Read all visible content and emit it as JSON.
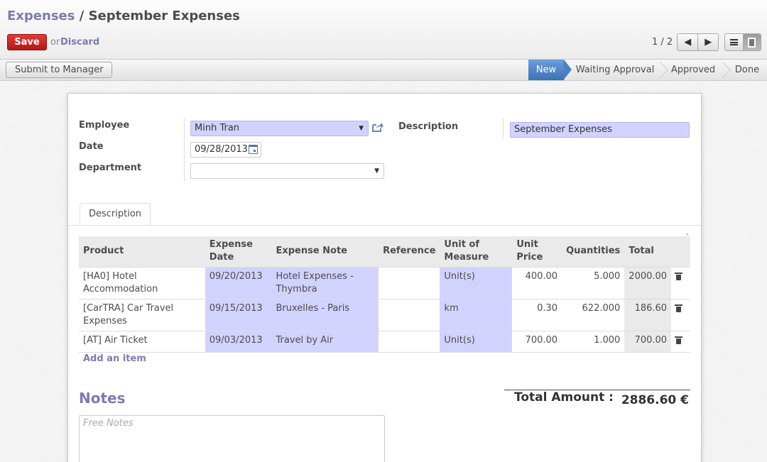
{
  "breadcrumb": {
    "parent": "Expenses",
    "separator": " / ",
    "current": "September Expenses"
  },
  "toolbar": {
    "save_label": "Save",
    "or_text": "or",
    "discard_label": "Discard"
  },
  "pager": {
    "text": "1 / 2",
    "prev_icon": "arrow-left-icon",
    "next_icon": "arrow-right-icon"
  },
  "view_switch": {
    "list_icon": "list-view-icon",
    "form_icon": "form-view-icon",
    "active": "form"
  },
  "statusbar": {
    "submit_label": "Submit to Manager",
    "stages": [
      {
        "label": "New",
        "active": true
      },
      {
        "label": "Waiting Approval",
        "active": false
      },
      {
        "label": "Approved",
        "active": false
      },
      {
        "label": "Done",
        "active": false
      }
    ]
  },
  "form": {
    "employee": {
      "label": "Employee",
      "value": "Minh Tran"
    },
    "date": {
      "label": "Date",
      "value": "09/28/2013"
    },
    "department": {
      "label": "Department",
      "value": ""
    },
    "description": {
      "label": "Description",
      "value": "September Expenses"
    }
  },
  "tabs": [
    {
      "label": "Description",
      "active": true
    }
  ],
  "lines": {
    "columns": [
      "Product",
      "Expense Date",
      "Expense Note",
      "Reference",
      "Unit of Measure",
      "Unit Price",
      "Quantities",
      "Total"
    ],
    "rows": [
      {
        "product": "[HA0] Hotel Accommodation",
        "date": "09/20/2013",
        "note": "Hotel Expenses - Thymbra",
        "reference": "",
        "uom": "Unit(s)",
        "price": "400.00",
        "qty": "5.000",
        "total": "2000.00"
      },
      {
        "product": "[CarTRA] Car Travel Expenses",
        "date": "09/15/2013",
        "note": "Bruxelles - Paris",
        "reference": "",
        "uom": "km",
        "price": "0.30",
        "qty": "622.000",
        "total": "186.60"
      },
      {
        "product": "[AT] Air Ticket",
        "date": "09/03/2013",
        "note": "Travel by Air",
        "reference": "",
        "uom": "Unit(s)",
        "price": "700.00",
        "qty": "1.000",
        "total": "700.00"
      }
    ],
    "add_label": "Add an item"
  },
  "notes": {
    "title": "Notes",
    "placeholder": "Free Notes"
  },
  "total": {
    "label": "Total Amount :",
    "value": "2886.60 €"
  },
  "colors": {
    "accent": "#7c7bad",
    "required": "#d2d2ff",
    "save": "#c9302c",
    "stage_active": "#4a7fc4"
  }
}
